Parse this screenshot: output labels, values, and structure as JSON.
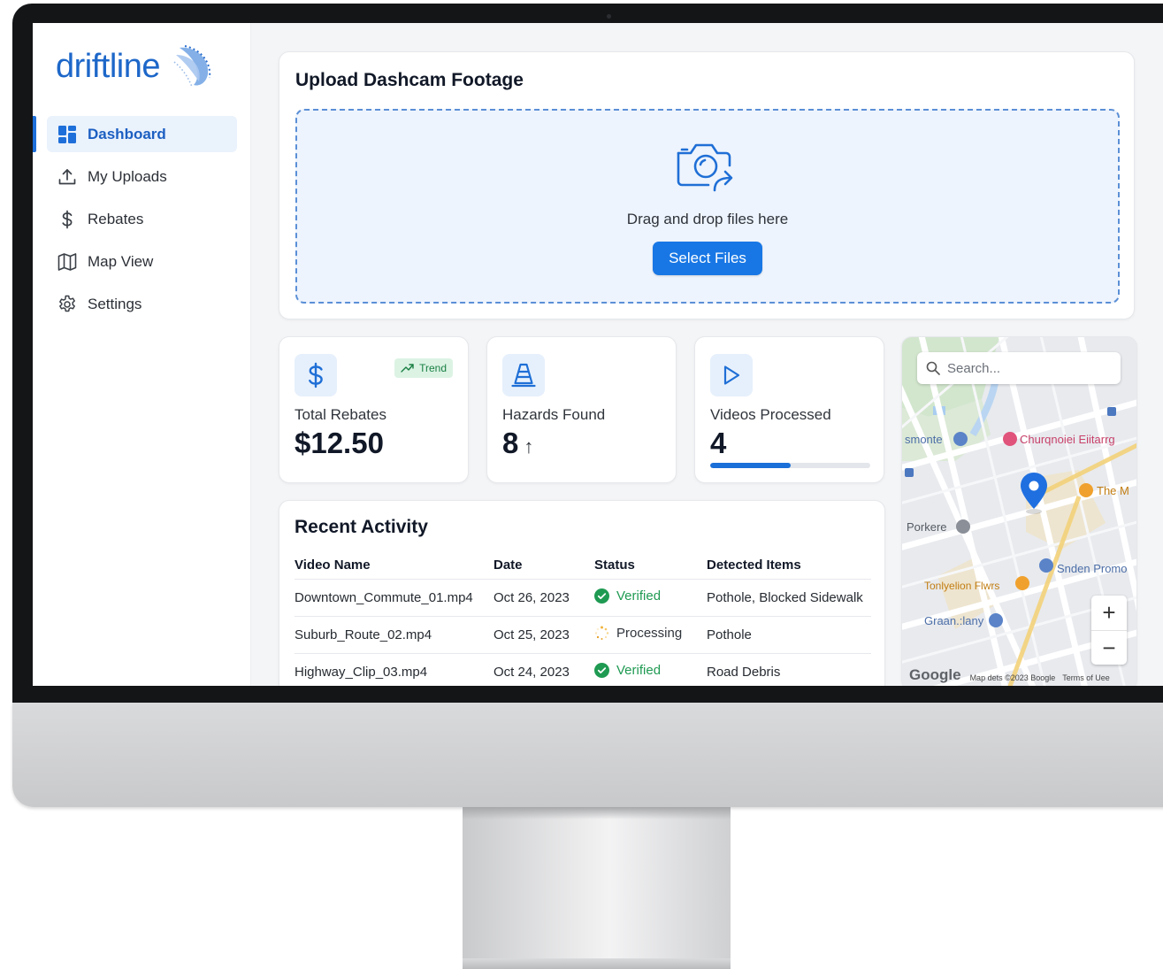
{
  "app": {
    "brand": "driftline",
    "accent": "#1e6fd9"
  },
  "sidebar": {
    "items": [
      {
        "label": "Dashboard",
        "icon": "dashboard-icon",
        "active": true
      },
      {
        "label": "My Uploads",
        "icon": "upload-icon",
        "active": false
      },
      {
        "label": "Rebates",
        "icon": "dollar-icon",
        "active": false
      },
      {
        "label": "Map View",
        "icon": "map-icon",
        "active": false
      },
      {
        "label": "Settings",
        "icon": "gear-icon",
        "active": false
      }
    ]
  },
  "upload": {
    "title": "Upload Dashcam Footage",
    "drop_text": "Drag and drop files here",
    "button_label": "Select Files",
    "icon": "camera-upload-icon"
  },
  "stats": {
    "rebates": {
      "label": "Total Rebates",
      "value": "$12.50",
      "badge": "Trend",
      "icon": "dollar-icon"
    },
    "hazards": {
      "label": "Hazards Found",
      "value": "8",
      "arrow": "↑",
      "icon": "traffic-cone-icon"
    },
    "videos": {
      "label": "Videos Processed",
      "value": "4",
      "progress": 0.5,
      "icon": "play-icon"
    }
  },
  "activity": {
    "title": "Recent Activity",
    "columns": [
      "Video Name",
      "Date",
      "Status",
      "Detected Items"
    ],
    "rows": [
      {
        "name": "Downtown_Commute_01.mp4",
        "date": "Oct 26, 2023",
        "status": "Verified",
        "items": "Pothole, Blocked Sidewalk"
      },
      {
        "name": "Suburb_Route_02.mp4",
        "date": "Oct 25, 2023",
        "status": "Processing",
        "items": "Pothole"
      },
      {
        "name": "Highway_Clip_03.mp4",
        "date": "Oct 24, 2023",
        "status": "Verified",
        "items": "Road Debris"
      }
    ]
  },
  "map": {
    "search_placeholder": "Search...",
    "places": [
      "smonte",
      "Churqnoiei Eiitarrg",
      "The M",
      "Porkere",
      "Snden Promo",
      "Tonlyelion Flwrs",
      "Graan.:lany"
    ],
    "zoom_in": "+",
    "zoom_out": "−",
    "google": "Google",
    "attribution": "Map dets ©2023 Boogle",
    "terms": "Terms of Uee"
  }
}
